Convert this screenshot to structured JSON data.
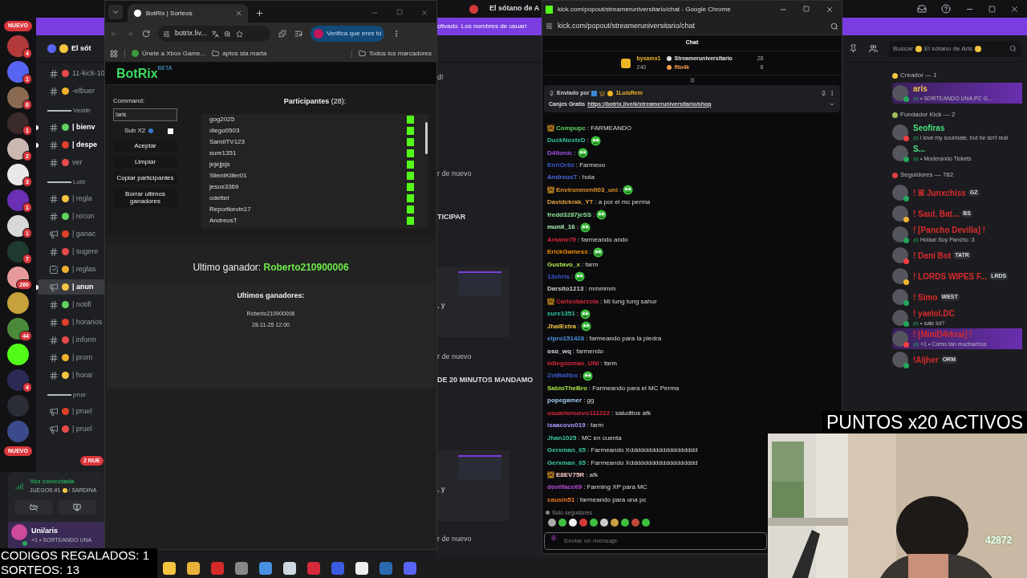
{
  "discord": {
    "title": "El sótano de A",
    "banner": "ctivado. Los nombres de usuari",
    "server_name": "El sót",
    "new_pills": [
      "NUEVO",
      "NUEVO"
    ],
    "servers": [
      {
        "badge": "4",
        "color": "#b23a3a"
      },
      {
        "badge": "1",
        "color": "#5865f2"
      },
      {
        "badge": "6",
        "color": "#8a6a50"
      },
      {
        "badge": "1",
        "color": "#3a2a2a"
      },
      {
        "badge": "2",
        "color": "#c9b8b0"
      },
      {
        "badge": "3",
        "color": "#e8e8e8"
      },
      {
        "badge": "1",
        "color": "#6b2fb3"
      },
      {
        "badge": "1",
        "color": "#d8d8d8"
      },
      {
        "badge": "7",
        "color": "#1f3a2f"
      },
      {
        "badge": "260",
        "color": "#e89a9a"
      },
      {
        "color": "#c7a23a"
      },
      {
        "badge": "44",
        "color": "#4a8a3a"
      },
      {
        "color": "#53fc18"
      },
      {
        "badge": "4",
        "color": "#2a2a55"
      },
      {
        "color": "#2a2d35"
      },
      {
        "color": "#3a4a8a"
      }
    ],
    "channels": [
      {
        "kind": "text",
        "name": "11-kick-10",
        "unread": false,
        "selected": false
      },
      {
        "kind": "text",
        "name": "-elbuer",
        "unread": false,
        "selected": false
      },
      {
        "kind": "category",
        "name": "Vestib",
        "unread": false,
        "selected": false
      },
      {
        "kind": "text",
        "name": "| bienv",
        "unread": true,
        "selected": false
      },
      {
        "kind": "text",
        "name": "| despe",
        "unread": true,
        "selected": false
      },
      {
        "kind": "text",
        "name": "ver",
        "unread": false,
        "selected": false
      },
      {
        "kind": "category",
        "name": "Lobl",
        "unread": false,
        "selected": false
      },
      {
        "kind": "text",
        "name": "| regla",
        "unread": false,
        "selected": false
      },
      {
        "kind": "text",
        "name": "| recon",
        "unread": false,
        "selected": false
      },
      {
        "kind": "announce",
        "name": "| ganac",
        "unread": false,
        "selected": false
      },
      {
        "kind": "text",
        "name": "| sugere",
        "unread": false,
        "selected": false
      },
      {
        "kind": "rules",
        "name": "| reglas",
        "unread": false,
        "selected": false
      },
      {
        "kind": "announce",
        "name": "| anun",
        "unread": true,
        "selected": true
      },
      {
        "kind": "text",
        "name": "| notifi",
        "unread": false,
        "selected": false
      },
      {
        "kind": "text",
        "name": "| horarios",
        "unread": false,
        "selected": false
      },
      {
        "kind": "text",
        "name": "| inform",
        "unread": false,
        "selected": false
      },
      {
        "kind": "text",
        "name": "| prom",
        "unread": false,
        "selected": false
      },
      {
        "kind": "text",
        "name": "| horar",
        "unread": false,
        "selected": false
      },
      {
        "kind": "category",
        "name": "prue",
        "unread": false,
        "selected": false
      },
      {
        "kind": "announce",
        "name": "| pruel",
        "unread": false,
        "selected": false
      },
      {
        "kind": "announce",
        "name": "| pruel",
        "unread": false,
        "selected": false
      }
    ],
    "mention_pill": "2 NUE",
    "voice": {
      "status": "Voz conectada",
      "channel": "JUEGOS #1",
      "subchannel": "/ SARDINA"
    },
    "user": {
      "name": "Uni/aris",
      "status": "+1 • SORTEANDO UNA"
    },
    "behind": [
      {
        "kind": "text",
        "text": "d!"
      },
      {
        "kind": "text",
        "text": "r de nuevo"
      },
      {
        "kind": "text",
        "text": "TICIPAR"
      },
      {
        "kind": "card",
        "text": ", y"
      },
      {
        "kind": "text",
        "text": "r de nuevo"
      },
      {
        "kind": "text",
        "text": "DE 20 MINUTOS MANDAMO"
      },
      {
        "kind": "card",
        "text": ", y"
      },
      {
        "kind": "text",
        "text": "r de nuevo"
      }
    ],
    "search": {
      "before": "Buscar",
      "after": "El sótano de Aris"
    },
    "member_groups": [
      {
        "title": "Creador — 1",
        "members": [
          {
            "name": "aris",
            "color": "#f0c34a",
            "presence": {
              "color": "#23a55a"
            },
            "status": "• SORTEANDO UNA PC G...",
            "highlight": true
          }
        ]
      },
      {
        "title": "Fundador Kick — 2",
        "members": [
          {
            "name": "Seofiras",
            "color": "#4ade80",
            "presence": {
              "color": "#f23f43"
            },
            "status": "i love my soulmate, but he isn't real",
            "highlight": false
          },
          {
            "name": "S...",
            "color": "#4ade80",
            "presence": {
              "color": "#23a55a"
            },
            "status": "• Moderando Tickets",
            "highlight": false
          }
        ]
      },
      {
        "title": "Seguidores — 782",
        "members": [
          {
            "name": "! ꕤ Junxchiss",
            "color": "#d92b2b",
            "presence": {
              "color": "#23a55a"
            },
            "tag": "GZ",
            "highlight": false
          },
          {
            "name": "! Saul, Bat...",
            "color": "#d92b2b",
            "presence": {
              "color": "#f0b232"
            },
            "tag": "BS",
            "highlight": false
          },
          {
            "name": "! [Pancho Devilla] !",
            "color": "#d92b2b",
            "presence": {
              "color": "#23a55a"
            },
            "status": "Holaa! Soy Pancho :3",
            "highlight": false
          },
          {
            "name": "! Dani Bot",
            "color": "#d92b2b",
            "presence": {
              "color": "#f23f43"
            },
            "tag": "TATR",
            "highlight": false
          },
          {
            "name": "! LORDS WIPES F...",
            "color": "#d92b2b",
            "presence": {
              "color": "#f0b232"
            },
            "tag": "LRDS",
            "highlight": false
          },
          {
            "name": "! Simo",
            "color": "#d92b2b",
            "presence": {
              "color": "#23a55a"
            },
            "tag": "WEST",
            "highlight": false
          },
          {
            "name": "! yaelol.DC",
            "color": "#d92b2b",
            "presence": {
              "color": "#23a55a"
            },
            "status": "• sale lol?",
            "highlight": false
          },
          {
            "name": "! [MiniD4rkrai] !",
            "color": "#d92b2b",
            "presence": {
              "color": "#f23f43"
            },
            "status": "+1 • Como tan muchachos",
            "highlight": true
          },
          {
            "name": "!Aljher",
            "color": "#d92b2b",
            "presence": {
              "color": "#23a55a"
            },
            "tag": "ORM",
            "highlight": false
          }
        ]
      }
    ]
  },
  "botrix": {
    "tab": "BotRix | Sorteos",
    "url": "botrix.liv...",
    "profile": "Verifica que eres tú",
    "bookmarks": [
      "Únete a Xbox Game...",
      "aptos sta marta"
    ],
    "all_bookmarks": "Todos los marcadores",
    "logo": "BotRix",
    "logo_badge": "BETA",
    "command_label": "Command:",
    "command": "!aris",
    "sub_label": "Sub X2",
    "sub_checked": false,
    "buttons": [
      "Aceptar",
      "Limpiar",
      "Copiar participantes",
      "Borrar ultimos ganadores"
    ],
    "participants_label": "Participantes",
    "participants_count": "(28):",
    "participants": [
      "gog2025",
      "diego0503",
      "SamiITV123",
      "sure1351",
      "jejejjsjs",
      "SilentKiller01",
      "jesus3369",
      "odettet",
      "Reportkevin17",
      "AndreusT"
    ],
    "last_winner_label": "Ultimo ganador:",
    "last_winner": "Roberto210900006",
    "winners_label": "Ultimos ganadores:",
    "winners": [
      {
        "name": "Roberto210900006",
        "date": "28-11-25 12:00"
      }
    ]
  },
  "kick": {
    "title": "kick.com/popout/streameruniversitario/chat - Google Chrome",
    "url": "kick.com/popout/streameruniversitario/chat",
    "header": "Chat",
    "leaders": [
      {
        "name": "bysamx1",
        "count": "240",
        "color": "#f0b429"
      },
      {
        "name": "Streameruniversitario",
        "count": "28",
        "color": "#e5e5e5"
      },
      {
        "name": "fito4k",
        "count": "8",
        "color": "#f0a050"
      }
    ],
    "pinned": {
      "by": "Enviado por",
      "user": "1LuisRem",
      "prefix": "Canjes Gratis",
      "link": "https://botrix.live/k/streameruniversitario/shop"
    },
    "messages": [
      {
        "kind": "text",
        "user": "Compupc",
        "color": "#5fd35f",
        "text": ": FARMEANDO",
        "badge": true
      },
      {
        "kind": "emote",
        "user": "DuckNoxtxD",
        "color": "#2fc4a0",
        "text": ":",
        "badge": false
      },
      {
        "kind": "emote",
        "user": "D4ltonic",
        "color": "#a04de0",
        "text": ":",
        "badge": false
      },
      {
        "kind": "text",
        "user": "EnriOrtiz",
        "color": "#3a5bd0",
        "text": ": Farmeoo",
        "badge": false
      },
      {
        "kind": "text",
        "user": "AndreusT",
        "color": "#4a6ae0",
        "text": ": hola",
        "badge": false
      },
      {
        "kind": "emote",
        "user": "Environmentt03_uni",
        "color": "#e0902a",
        "text": ":",
        "badge": true
      },
      {
        "kind": "text",
        "user": "Davidckrak_YT",
        "color": "#e0a040",
        "text": ": a por el mc perma",
        "badge": false
      },
      {
        "kind": "emote",
        "user": "fredd3287jeSS",
        "color": "#8ce99a",
        "text": ":",
        "badge": false
      },
      {
        "kind": "emote",
        "user": "munil_16",
        "color": "#b2f2bb",
        "text": ":",
        "badge": false
      },
      {
        "kind": "text",
        "user": "Arkane79",
        "color": "#d6283a",
        "text": ": farmeando ando",
        "badge": false
      },
      {
        "kind": "emote",
        "user": "ErickGamess",
        "color": "#f08c00",
        "text": ":",
        "badge": false
      },
      {
        "kind": "text",
        "user": "Gustavo_x",
        "color": "#a9e34b",
        "text": ": farm",
        "badge": false
      },
      {
        "kind": "emote",
        "user": "13chris",
        "color": "#3b5bdb",
        "text": ":",
        "badge": false
      },
      {
        "kind": "text",
        "user": "Darsito1213",
        "color": "#c9c9c9",
        "text": ": mmmmm",
        "badge": false
      },
      {
        "kind": "text",
        "user": "Carlosbarzola",
        "color": "#d6283a",
        "text": ": Mi tung tung sahur",
        "badge": true
      },
      {
        "kind": "emote",
        "user": "sure1351",
        "color": "#2fc4a0",
        "text": ":",
        "badge": false
      },
      {
        "kind": "emote",
        "user": "JhalExtra",
        "color": "#f5c542",
        "text": ":",
        "badge": false
      },
      {
        "kind": "text",
        "user": "elpro151428",
        "color": "#4d8fe0",
        "text": ": farmeando para la piedra",
        "badge": false
      },
      {
        "kind": "text",
        "user": "oso_wq",
        "color": "#d0d8e0",
        "text": ": farmendo",
        "badge": false
      },
      {
        "kind": "text",
        "user": "lidiegozman_UNI",
        "color": "#d6283a",
        "text": ": farm",
        "badge": false
      },
      {
        "kind": "emote",
        "user": "ZetBalltes",
        "color": "#3a5bd0",
        "text": ":",
        "badge": false
      },
      {
        "kind": "text",
        "user": "SabioTheBro",
        "color": "#a9e34b",
        "text": ": Farmeando para el MC Perma",
        "badge": false
      },
      {
        "kind": "text",
        "user": "popegamer",
        "color": "#a5c8f0",
        "text": ": gg",
        "badge": false
      },
      {
        "kind": "text",
        "user": "usuarionuevo111222",
        "color": "#d6283a",
        "text": ": saluditos afk",
        "badge": false
      },
      {
        "kind": "text",
        "user": "isaacovo019",
        "color": "#b197fc",
        "text": ": farm",
        "badge": false
      },
      {
        "kind": "text",
        "user": "Jhan1025",
        "color": "#38c9a0",
        "text": ": MC en cuenta",
        "badge": false
      },
      {
        "kind": "text",
        "user": "Gerxman_65",
        "color": "#38c9a1",
        "text": ": Farmeando Xddddddddddddddddddd",
        "badge": false
      },
      {
        "kind": "text",
        "user": "Gerxman_65",
        "color": "#38c9a2",
        "text": ": Farmeando Xddddddddddddddddddd",
        "badge": false
      },
      {
        "kind": "text",
        "user": "E8EV75R",
        "color": "#ffc9c9",
        "text": ": afk",
        "badge": true
      },
      {
        "kind": "text",
        "user": "devilface69",
        "color": "#be4bdb",
        "text": ": Farming XP para MC",
        "badge": false
      },
      {
        "kind": "text",
        "user": "causin51",
        "color": "#f07a20",
        "text": ": farmeando para una pc",
        "badge": false
      }
    ],
    "followers_only": "Solo seguidores",
    "placeholder": "Enviar un mensaje"
  },
  "overlay": {
    "codes": "CODIGOS REGALADOS: 1",
    "raffles": "SORTEOS: 13",
    "points": "PUNTOS x20 ACTIVOS",
    "cam_counter": "42872"
  }
}
